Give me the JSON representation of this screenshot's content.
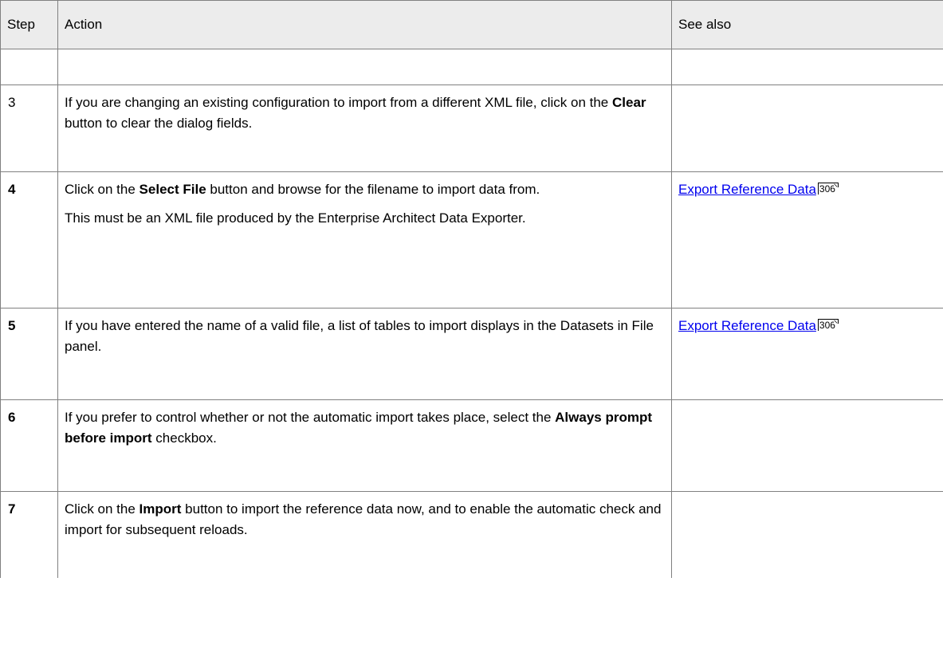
{
  "headers": {
    "step": "Step",
    "action": "Action",
    "see_also": "See also"
  },
  "rows": [
    {
      "step": "",
      "action": [],
      "see_also": []
    },
    {
      "step": "3",
      "action": [
        {
          "parts": [
            "If you are changing an existing configuration to import from a different XML file, click on the ",
            "Clear",
            " button to clear the dialog fields."
          ]
        }
      ],
      "see_also": []
    },
    {
      "step": "4",
      "action": [
        {
          "parts": [
            "Click on the ",
            "Select File",
            " button and browse for the filename to import data from."
          ]
        },
        {
          "parts": [
            "This must be an XML file produced by the Enterprise Architect Data Exporter."
          ]
        }
      ],
      "see_also": [
        {
          "label": "Export Reference Data",
          "page": "306"
        }
      ]
    },
    {
      "step": "5",
      "action": [
        {
          "parts": [
            "If you have entered the name of a valid file, a list of tables to import displays in the Datasets in File panel."
          ]
        }
      ],
      "see_also": [
        {
          "label": "Export Reference Data",
          "page": "306"
        }
      ]
    },
    {
      "step": "6",
      "action": [
        {
          "parts": [
            "If you prefer to control whether or not the automatic import takes place, select the ",
            "Always prompt before import",
            " checkbox."
          ]
        }
      ],
      "see_also": []
    },
    {
      "step": "7",
      "action": [
        {
          "parts": [
            "Click on the ",
            "Import",
            " button to import the reference data now, and to enable the automatic check and import for subsequent reloads."
          ]
        }
      ],
      "see_also": []
    }
  ]
}
